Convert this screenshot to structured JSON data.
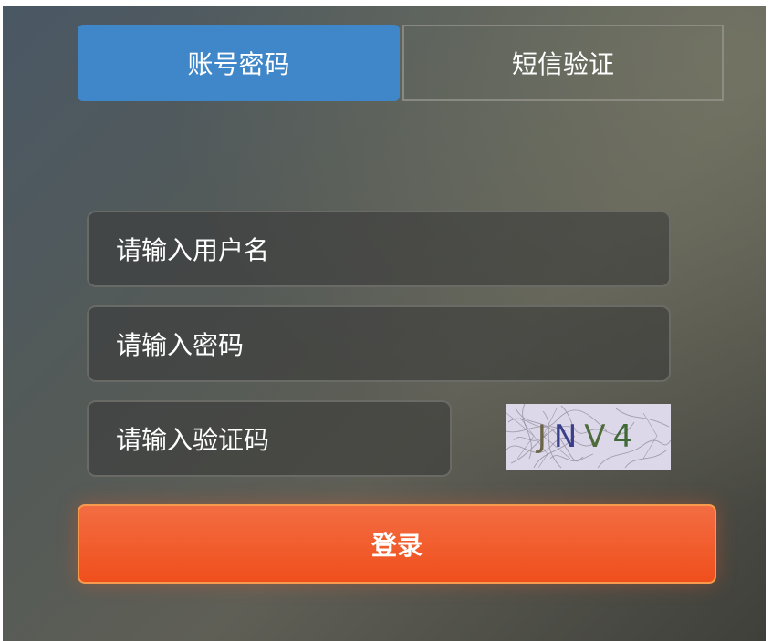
{
  "tabs": {
    "account_password": "账号密码",
    "sms_verification": "短信验证"
  },
  "form": {
    "username_placeholder": "请输入用户名",
    "password_placeholder": "请输入密码",
    "captcha_placeholder": "请输入验证码",
    "captcha_chars": [
      "J",
      "N",
      "V",
      "4"
    ]
  },
  "login_label": "登录",
  "colors": {
    "active_tab": "#3f87c9",
    "login_button": "#f04f1c",
    "captcha_bg": "#dcd8ea"
  }
}
